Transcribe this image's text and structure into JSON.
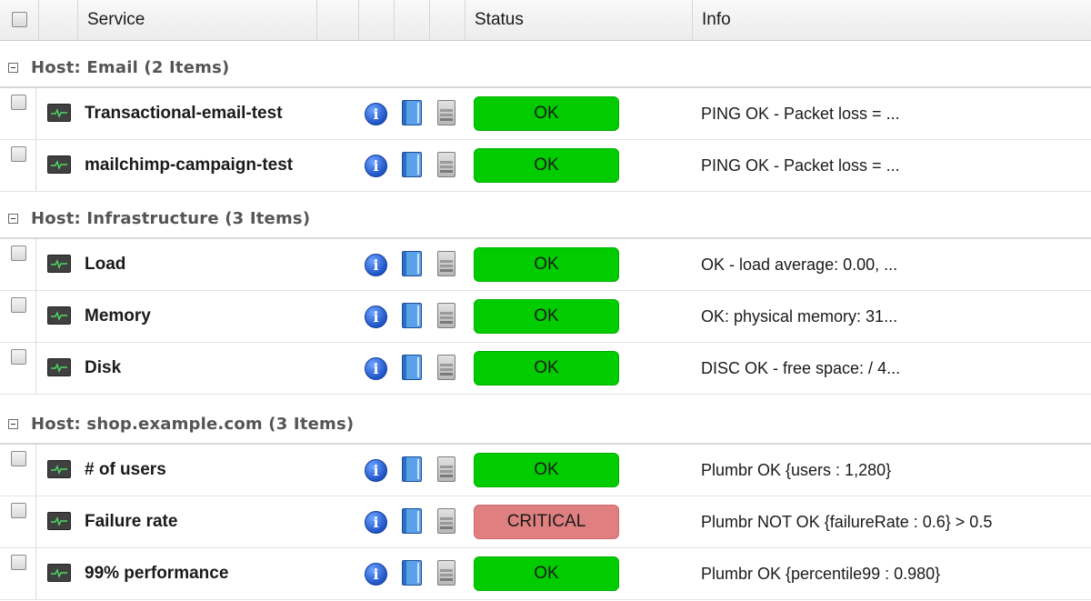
{
  "columns": {
    "service": "Service",
    "status": "Status",
    "info": "Info"
  },
  "groups": [
    {
      "label": "Host: Email (2 Items)",
      "rows": [
        {
          "service": "Transactional-email-test",
          "status": "OK",
          "state": "ok",
          "info": "PING OK - Packet loss = ..."
        },
        {
          "service": "mailchimp-campaign-test",
          "status": "OK",
          "state": "ok",
          "info": "PING OK - Packet loss = ..."
        }
      ]
    },
    {
      "label": "Host: Infrastructure (3 Items)",
      "rows": [
        {
          "service": "Load",
          "status": "OK",
          "state": "ok",
          "info": "OK - load average: 0.00, ..."
        },
        {
          "service": "Memory",
          "status": "OK",
          "state": "ok",
          "info": "OK: physical memory: 31..."
        },
        {
          "service": "Disk",
          "status": "OK",
          "state": "ok",
          "info": "DISC OK - free space: / 4..."
        }
      ]
    },
    {
      "label": "Host: shop.example.com (3 Items)",
      "rows": [
        {
          "service": "# of users",
          "status": "OK",
          "state": "ok",
          "info": "Plumbr OK {users : 1,280}"
        },
        {
          "service": "Failure rate",
          "status": "CRITICAL",
          "state": "critical",
          "info": "Plumbr NOT OK {failureRate : 0.6} > 0.5"
        },
        {
          "service": "99% performance",
          "status": "OK",
          "state": "ok",
          "info": "Plumbr OK {percentile99 : 0.980}"
        }
      ]
    }
  ],
  "colors": {
    "ok": "#00cc00",
    "critical": "#e07f7f"
  },
  "icons": {
    "service": "monitor-icon",
    "details": "info-icon",
    "docs": "book-icon",
    "host": "server-icon"
  }
}
